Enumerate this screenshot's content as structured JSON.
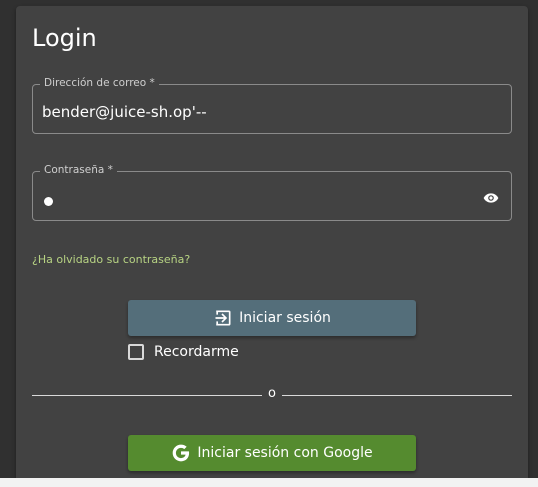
{
  "login": {
    "title": "Login",
    "email": {
      "label": "Dirección de correo *",
      "value": "bender@juice-sh.op'--"
    },
    "password": {
      "label": "Contraseña *",
      "visibility_icon": "eye-icon"
    },
    "forgot_password": "¿Ha olvidado su contraseña?",
    "login_button": {
      "label": "Iniciar sesión",
      "icon": "login-icon"
    },
    "remember_me": {
      "label": "Recordarme",
      "checked": false
    },
    "divider_text": "o",
    "google_button": {
      "label": "Iniciar sesión con Google",
      "icon": "google-icon"
    }
  },
  "colors": {
    "background": "#303030",
    "card": "#424242",
    "login_button": "#546e7a",
    "google_button": "#558b2f",
    "link": "#b7d383"
  }
}
